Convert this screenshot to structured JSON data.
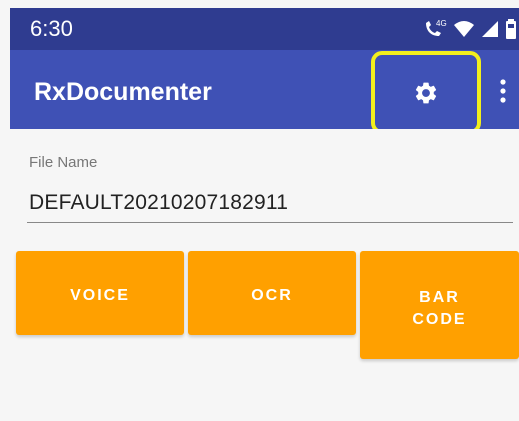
{
  "status_bar": {
    "time": "6:30",
    "network_label": "4G"
  },
  "app_bar": {
    "title": "RxDocumenter",
    "settings_icon": "gear-icon",
    "overflow_icon": "more-vert-icon",
    "highlight_color": "#f2ef1d"
  },
  "form": {
    "file_name_label": "File Name",
    "file_name_value": "DEFAULT20210207182911"
  },
  "buttons": {
    "voice": "VOICE",
    "ocr": "OCR",
    "barcode": "BAR\nCODE"
  },
  "colors": {
    "primary": "#3f51b5",
    "status": "#2f3c90",
    "accent": "#ffa000"
  }
}
